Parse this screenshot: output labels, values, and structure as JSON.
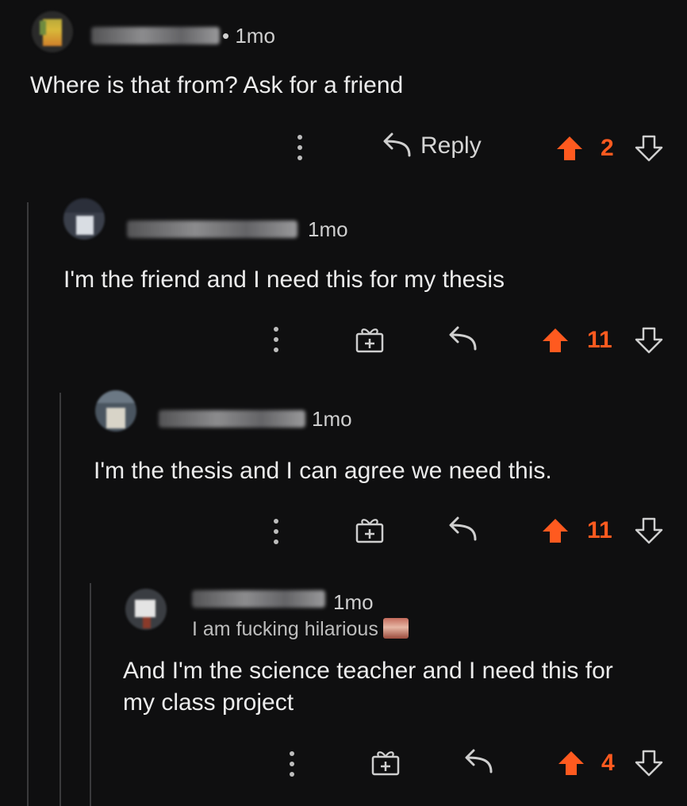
{
  "colors": {
    "background": "#0f0f10",
    "upvote": "#ff5a1f",
    "text": "#ececec",
    "muted": "#bdbdbd"
  },
  "icons": [
    "overflow-dots-icon",
    "reply-arrow-icon",
    "gift-icon",
    "upvote-arrow-icon",
    "downvote-arrow-icon"
  ],
  "comments": [
    {
      "time": "• 1mo",
      "body": [
        "Where is that from? Ask for a friend"
      ],
      "reply_label": "Reply",
      "votes": "2"
    },
    {
      "time": "1mo",
      "body": [
        "I'm the friend and I need this for my thesis"
      ],
      "votes": "11"
    },
    {
      "time": "1mo",
      "body": [
        "I'm the thesis and I can agree we need this."
      ],
      "votes": "11"
    },
    {
      "time": "1mo",
      "flair": "I am fucking hilarious",
      "body": [
        "And I'm the science teacher and I need this for",
        "my class project"
      ],
      "votes": "4"
    }
  ]
}
